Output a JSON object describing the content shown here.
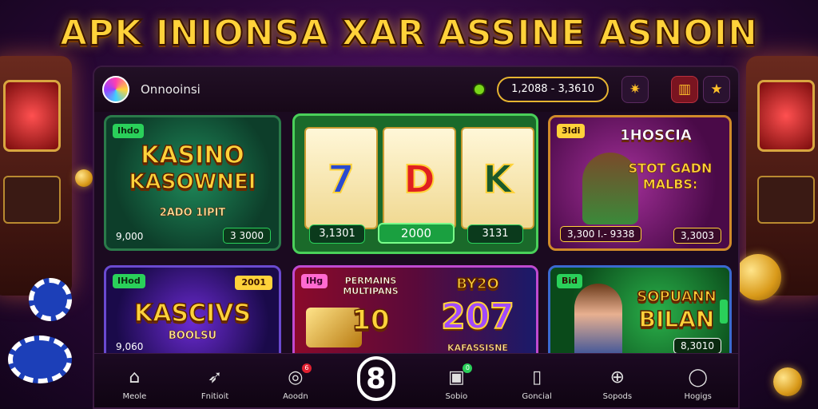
{
  "headline": "APK INIONSA XAR ASSINE ASNOIN",
  "app": {
    "name": "Onnooinsi"
  },
  "wallet": {
    "balance": "1,2088 - 3,3610"
  },
  "tiles": [
    {
      "tag": "Ihdo",
      "title": "KASINO",
      "title2": "KASOWNEI",
      "sub": "2ADO 1IPIT",
      "left_value": "9,000",
      "right_value": "3 3000"
    },
    {
      "reel_symbols": [
        "7",
        "D",
        "K"
      ],
      "left_value": "3,1301",
      "center_value": "2000",
      "right_value": "3131"
    },
    {
      "tag": "3Idi",
      "header": "1HOSCIA",
      "title": "STOT GADN MALBS:",
      "left_value": "3,300 I.- 9338",
      "right_value": "3,3003"
    },
    {
      "tag": "IHod",
      "tag2": "2001",
      "title": "KASCIVS",
      "sub": "BOOLSU",
      "left_value": "9,060"
    },
    {
      "tag": "IHg",
      "title": "PERMAINS MULTIPANS",
      "number": "10",
      "side_title": "BY2O",
      "side_number": "207",
      "side_sub": "KAFASSISNE"
    },
    {
      "tag": "Bid",
      "title": "SOPUANN",
      "title2": "BILAN",
      "right_value": "8,3010"
    }
  ],
  "nav": [
    {
      "label": "Meole",
      "icon": "home-icon"
    },
    {
      "label": "Fnitioit",
      "icon": "rocket-icon"
    },
    {
      "label": "Aoodn",
      "icon": "chat-icon",
      "badge": "6"
    },
    {
      "label": "",
      "icon": "eight-logo-icon",
      "center_glyph": "8"
    },
    {
      "label": "Sobio",
      "icon": "camera-icon",
      "badge": "0"
    },
    {
      "label": "Goncial",
      "icon": "tablet-icon"
    },
    {
      "label": "Sopods",
      "icon": "target-icon"
    },
    {
      "label": "Hogigs",
      "icon": "circle-icon"
    }
  ]
}
